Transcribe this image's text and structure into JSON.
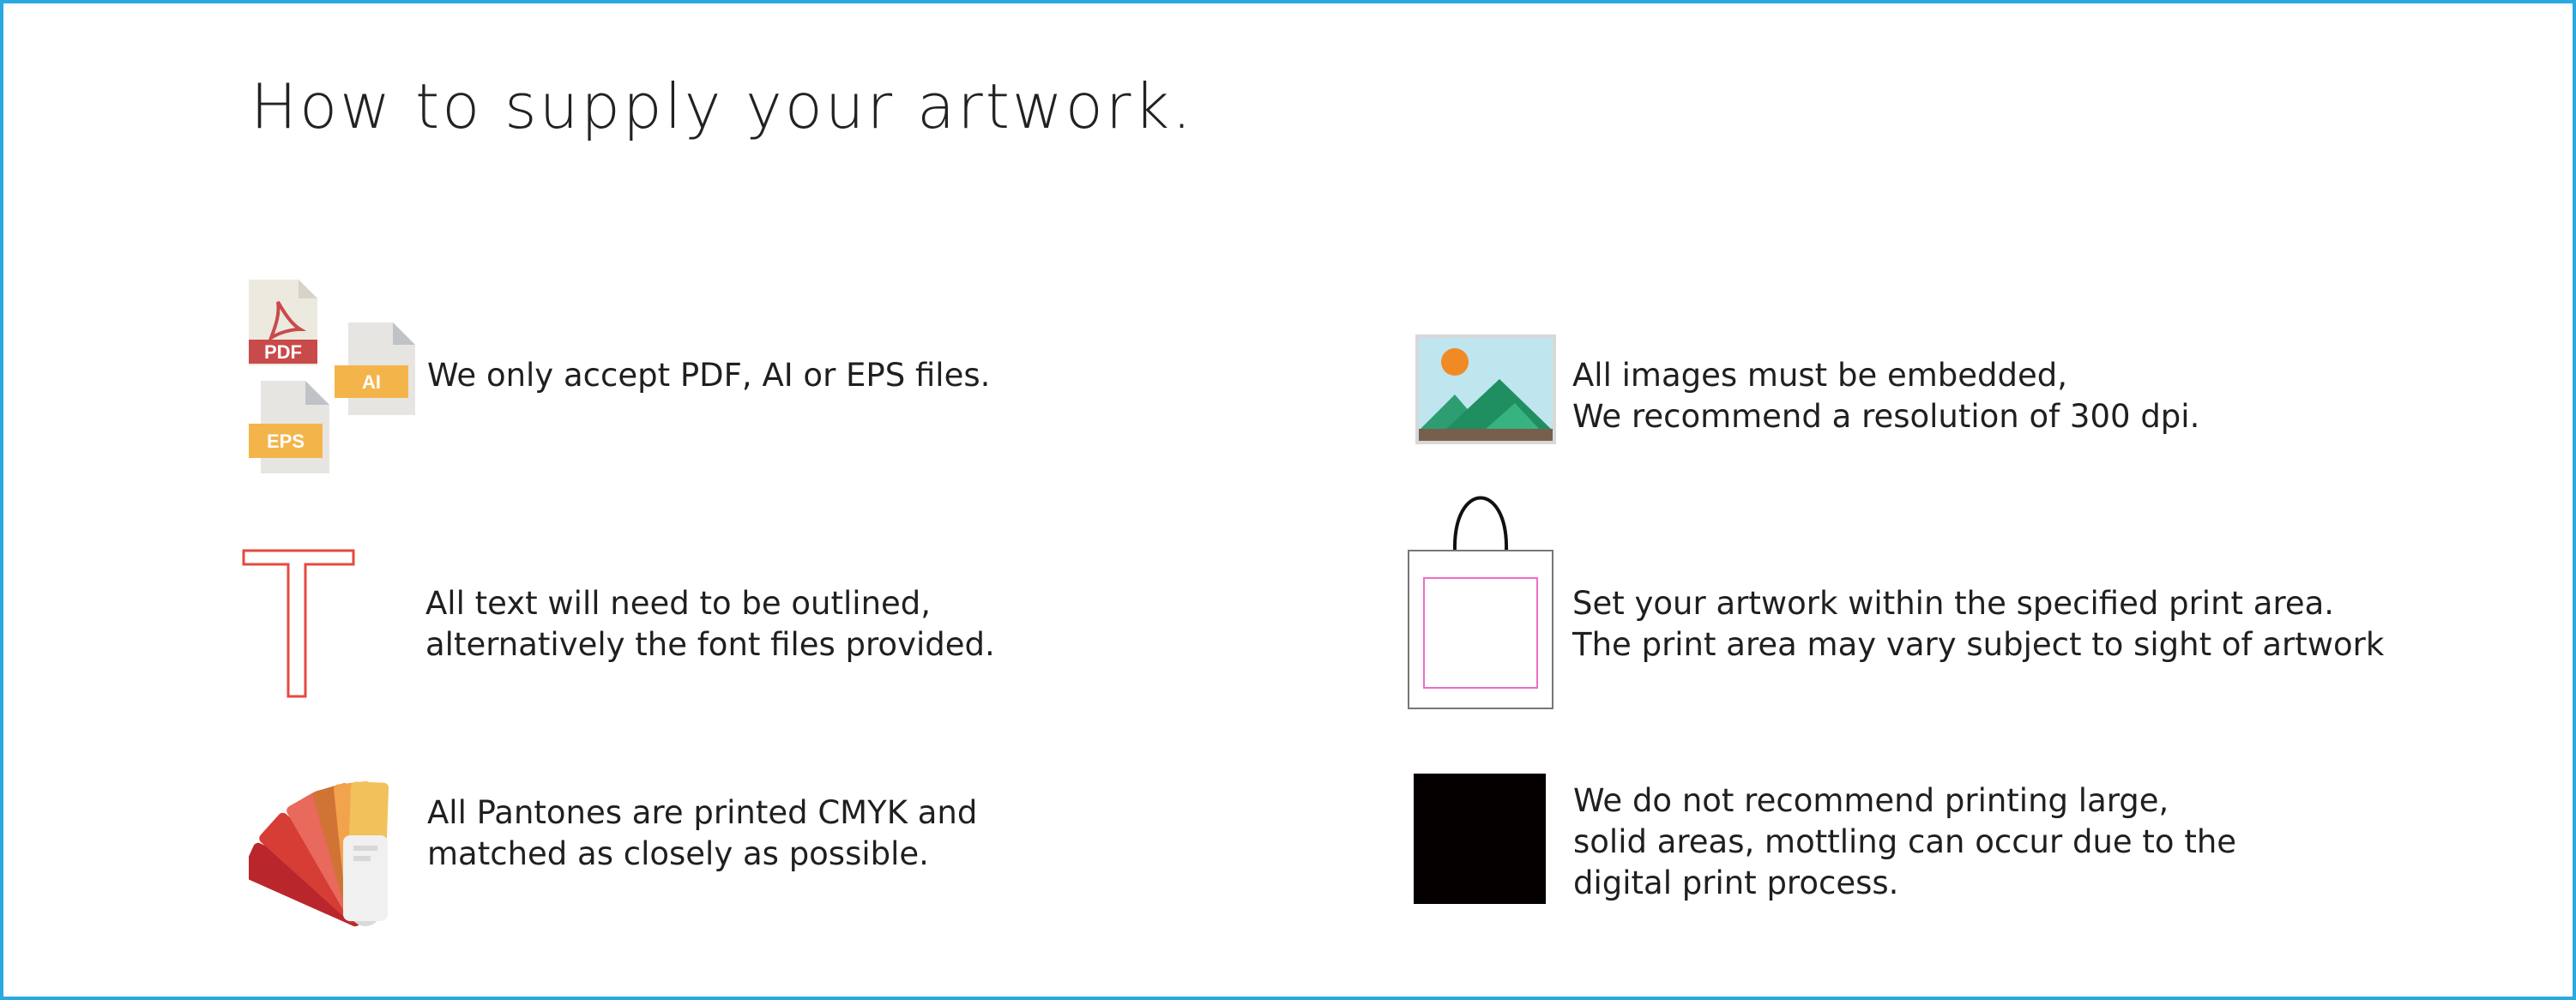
{
  "page": {
    "title": "How to supply your artwork."
  },
  "items": [
    {
      "icon": "file-format-icon",
      "icon_labels": [
        "PDF",
        "AI",
        "EPS"
      ],
      "lines": [
        "We only accept PDF, AI or EPS files."
      ]
    },
    {
      "icon": "image-icon",
      "lines": [
        "All images must be embedded,",
        "We recommend a resolution of 300 dpi."
      ]
    },
    {
      "icon": "text-outline-icon",
      "lines": [
        "All text will need to be outlined,",
        "alternatively the font files provided."
      ]
    },
    {
      "icon": "bag-print-area-icon",
      "lines": [
        "Set your artwork within the specified print area.",
        "The print area may vary subject to sight of artwork"
      ]
    },
    {
      "icon": "pantone-swatch-icon",
      "lines": [
        "All Pantones are printed CMYK and",
        "matched as closely as possible."
      ]
    },
    {
      "icon": "solid-area-icon",
      "lines": [
        "We do not recommend printing large,",
        "solid areas, mottling can occur due to the",
        "digital print process."
      ]
    }
  ],
  "colors": {
    "frame": "#2aa9e0",
    "pdf": "#c94a4a",
    "ai_eps": "#f3b54a",
    "text_outline": "#e34b3f",
    "print_area": "#f06cc6",
    "solid_area": "#050000"
  }
}
